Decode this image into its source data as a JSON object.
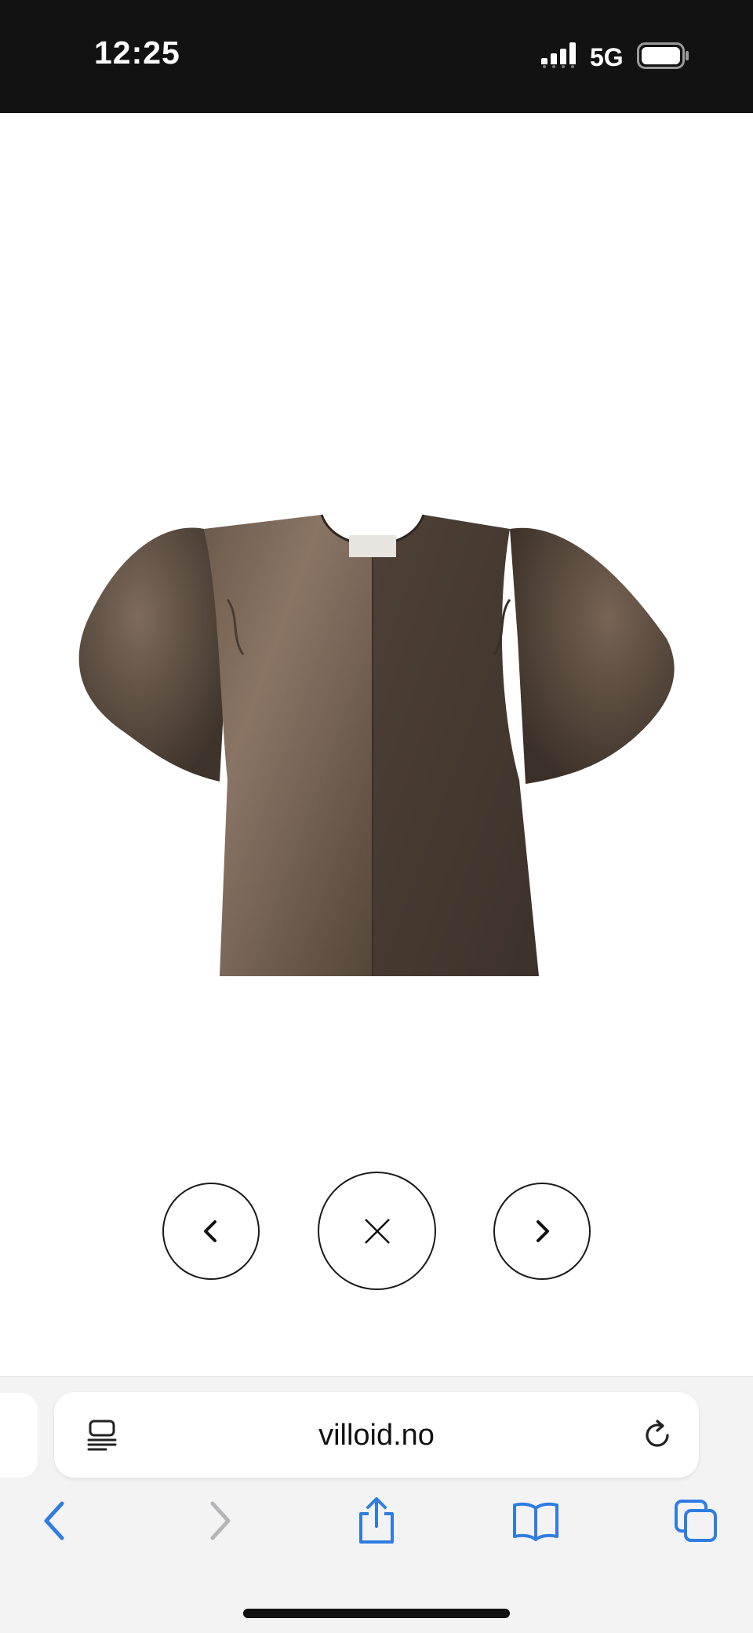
{
  "status_bar": {
    "time": "12:25",
    "network": "5G",
    "signal_icon": "cellular-signal-icon",
    "battery_icon": "battery-icon"
  },
  "viewer": {
    "product_image": "puff-sleeve-satin-top-image",
    "prev_icon": "chevron-left-icon",
    "close_icon": "close-icon",
    "next_icon": "chevron-right-icon"
  },
  "browser": {
    "url": "villoid.no",
    "reader_icon": "reader-mode-icon",
    "reload_icon": "reload-icon",
    "toolbar": {
      "back_icon": "back-arrow-icon",
      "forward_icon": "forward-arrow-icon",
      "share_icon": "share-icon",
      "bookmarks_icon": "bookmarks-icon",
      "tabs_icon": "tabs-icon"
    },
    "accent_color": "#2f7de1",
    "disabled_color": "#b5b5b8"
  }
}
